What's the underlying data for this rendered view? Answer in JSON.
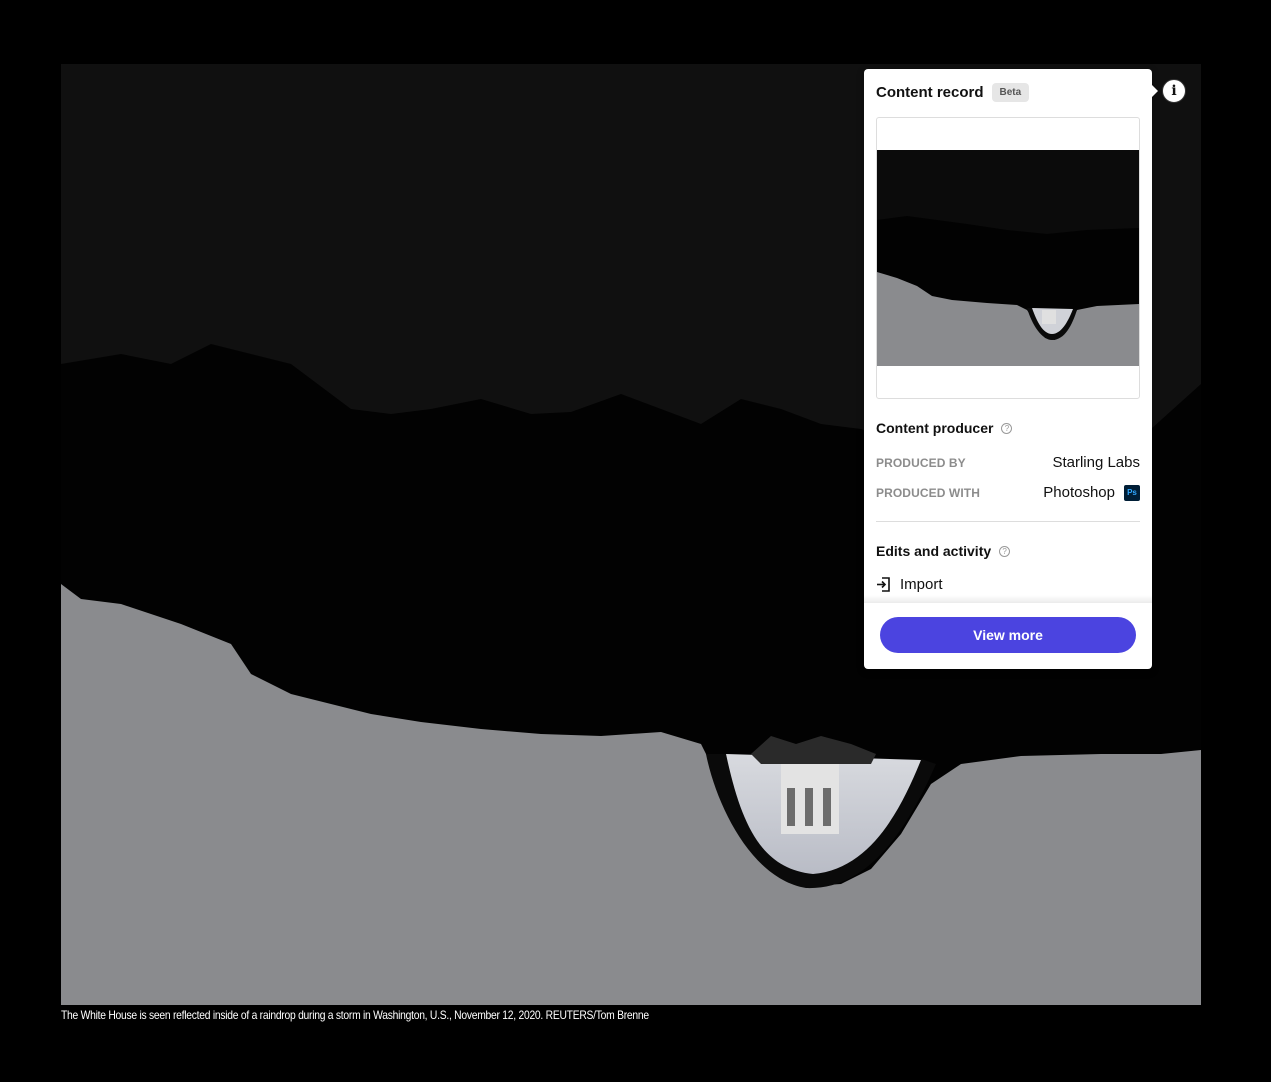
{
  "photo": {
    "caption": "The White House is seen reflected inside of a raindrop during a storm in Washington, U.S., November 12, 2020. REUTERS/Tom Brenne"
  },
  "info_button": {
    "icon": "info-icon",
    "glyph": "i"
  },
  "content_record": {
    "title": "Content record",
    "badge": "Beta",
    "producer_section": {
      "title": "Content producer",
      "help_icon": "help-icon",
      "help_glyph": "?",
      "rows": [
        {
          "label": "PRODUCED BY",
          "value": "Starling Labs"
        },
        {
          "label": "PRODUCED WITH",
          "value": "Photoshop",
          "app_icon": "photoshop-icon",
          "app_icon_text": "Ps"
        }
      ]
    },
    "edits_section": {
      "title": "Edits and activity",
      "help_glyph": "?",
      "items": [
        {
          "label": "Import",
          "icon": "import-icon"
        }
      ]
    },
    "view_more_label": "View more"
  },
  "colors": {
    "accent": "#4b44e0",
    "background": "#000000",
    "panel": "#ffffff",
    "photoshop_bg": "#001e36",
    "photoshop_fg": "#31a8ff"
  }
}
